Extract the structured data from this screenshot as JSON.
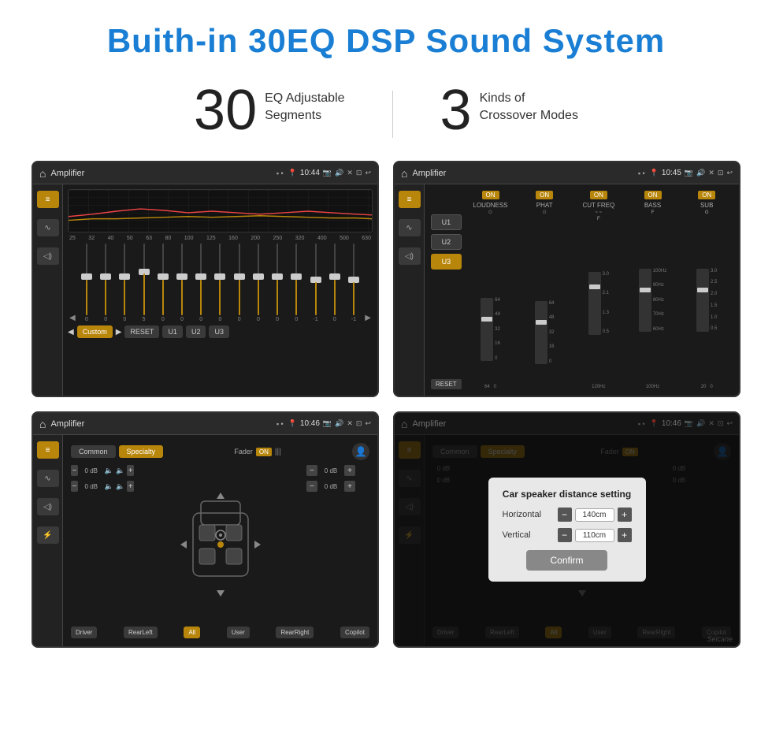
{
  "page": {
    "title": "Buith-in 30EQ DSP Sound System",
    "title_color": "#1a7fd4",
    "stat1_number": "30",
    "stat1_desc_line1": "EQ Adjustable",
    "stat1_desc_line2": "Segments",
    "stat2_number": "3",
    "stat2_desc_line1": "Kinds of",
    "stat2_desc_line2": "Crossover Modes"
  },
  "screen1": {
    "title": "Amplifier",
    "time": "10:44",
    "eq_labels": [
      "25",
      "32",
      "40",
      "50",
      "63",
      "80",
      "100",
      "125",
      "160",
      "200",
      "250",
      "320",
      "400",
      "500",
      "630"
    ],
    "eq_values": [
      "0",
      "0",
      "0",
      "0",
      "5",
      "0",
      "0",
      "0",
      "0",
      "0",
      "0",
      "0",
      "0",
      "-1",
      "0",
      "-1"
    ],
    "buttons": [
      "Custom",
      "RESET",
      "U1",
      "U2",
      "U3"
    ]
  },
  "screen2": {
    "title": "Amplifier",
    "time": "10:45",
    "u_buttons": [
      "U1",
      "U2",
      "U3"
    ],
    "active_u": "U3",
    "bands": [
      {
        "name": "LOUDNESS",
        "on": true,
        "g_label": "G"
      },
      {
        "name": "PHAT",
        "on": true,
        "g_label": "G"
      },
      {
        "name": "CUT FREQ",
        "on": true,
        "freq": "120Hz",
        "g_label": "F"
      },
      {
        "name": "BASS",
        "on": true,
        "freq": "100Hz",
        "g_label": "F"
      },
      {
        "name": "SUB",
        "on": true,
        "g_label": "G"
      }
    ],
    "reset_label": "RESET"
  },
  "screen3": {
    "title": "Amplifier",
    "time": "10:46",
    "tabs": [
      "Common",
      "Specialty"
    ],
    "active_tab": "Specialty",
    "fader_label": "Fader",
    "fader_on": "ON",
    "db_controls": [
      {
        "label": "0 dB",
        "position": "top-left"
      },
      {
        "label": "0 dB",
        "position": "top-right"
      },
      {
        "label": "0 dB",
        "position": "bottom-left"
      },
      {
        "label": "0 dB",
        "position": "bottom-right"
      }
    ],
    "bottom_buttons": [
      "Driver",
      "RearLeft",
      "All",
      "User",
      "RearRight",
      "Copilot"
    ],
    "all_active": true
  },
  "screen4": {
    "title": "Amplifier",
    "time": "10:46",
    "tabs": [
      "Common",
      "Specialty"
    ],
    "active_tab": "Specialty",
    "dialog": {
      "title": "Car speaker distance setting",
      "horizontal_label": "Horizontal",
      "horizontal_value": "140cm",
      "vertical_label": "Vertical",
      "vertical_value": "110cm",
      "confirm_label": "Confirm"
    },
    "bottom_buttons": [
      "Driver",
      "RearLeft",
      "All",
      "User",
      "RearRight",
      "Copilot"
    ]
  },
  "watermark": "Seicane"
}
